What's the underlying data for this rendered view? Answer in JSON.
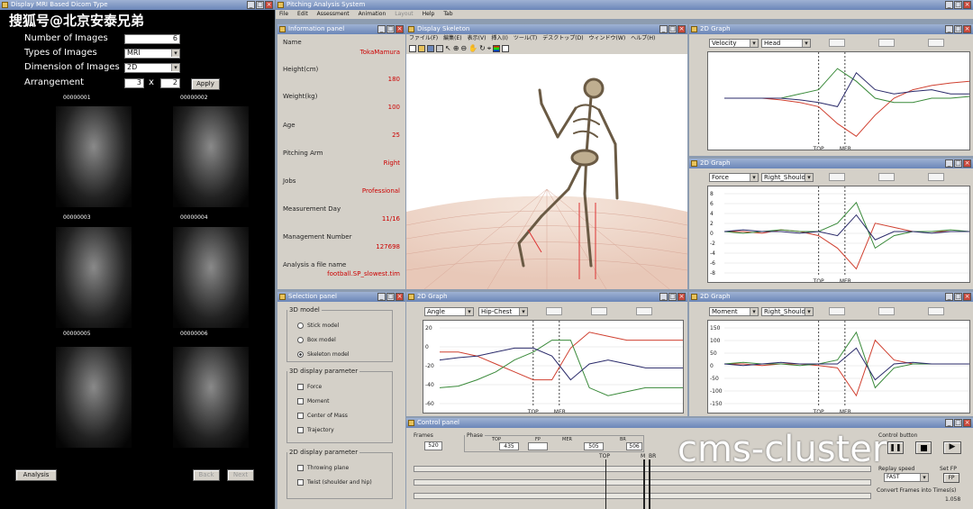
{
  "watermarks": {
    "top_left": "搜狐号@北京安泰兄弟",
    "bottom_right": "cms-cluster"
  },
  "mri_window": {
    "title": "Display MRI Based Dicom Type",
    "number_of_images_label": "Number of Images",
    "number_of_images_value": "6",
    "types_label": "Types of Images",
    "types_value": "MRI",
    "dimension_label": "Dimension of Images",
    "dimension_value": "2D",
    "arrangement_label": "Arrangement",
    "arrangement_rows": "3",
    "arrangement_x": "x",
    "arrangement_cols": "2",
    "apply_label": "Apply",
    "image_ids": [
      "00000001",
      "00000002",
      "00000003",
      "00000004",
      "00000005",
      "00000006"
    ],
    "analysis_label": "Analysis",
    "back_label": "Back",
    "next_label": "Next"
  },
  "main_window": {
    "title": "Pitching Analysis System",
    "menu": [
      "File",
      "Edit",
      "Assessment",
      "Animation",
      "Layout",
      "Help",
      "Tab"
    ]
  },
  "info_panel": {
    "title": "Information panel",
    "fields": [
      {
        "label": "Name",
        "value": "TokaMamura"
      },
      {
        "label": "Height(cm)",
        "value": "180"
      },
      {
        "label": "Weight(kg)",
        "value": "100"
      },
      {
        "label": "Age",
        "value": "25"
      },
      {
        "label": "Pitching Arm",
        "value": "Right"
      },
      {
        "label": "Jobs",
        "value": "Professional"
      },
      {
        "label": "Measurement Day",
        "value": "11/16"
      },
      {
        "label": "Management Number",
        "value": "127698"
      },
      {
        "label": "Analysis a file name",
        "value": "football.SP_slowest.tim"
      }
    ]
  },
  "display_window": {
    "title": "Display Skeleton",
    "menu": [
      "ファイル(F)",
      "編集(E)",
      "表示(V)",
      "挿入(I)",
      "ツール(T)",
      "デスクトップ(D)",
      "ウィンドウ(W)",
      "ヘルプ(H)"
    ]
  },
  "selection_panel": {
    "title": "Selection panel",
    "group_3d_model": "3D model",
    "models": [
      "Stick model",
      "Box model",
      "Skeleton model"
    ],
    "selected_model": "Skeleton model",
    "group_3d_params": "3D display parameter",
    "params_3d": [
      "Force",
      "Moment",
      "Center of Mass",
      "Trajectory"
    ],
    "group_2d_params": "2D display parameter",
    "params_2d": [
      "Throwing plane",
      "Twist (shoulder and hip)"
    ]
  },
  "graphs": [
    {
      "title": "2D Graph",
      "quantity": "Velocity",
      "segment": "Head",
      "yticks": [],
      "markers": [
        "TOP",
        "MER"
      ]
    },
    {
      "title": "2D Graph",
      "quantity": "Force",
      "segment": "Right_Shoulder",
      "yticks": [
        "8",
        "6",
        "4",
        "2",
        "0",
        "-2",
        "-4",
        "-6",
        "-8"
      ],
      "markers": [
        "TOP",
        "MER"
      ]
    },
    {
      "title": "2D Graph",
      "quantity": "Angle",
      "segment": "Hip-Chest",
      "yticks": [
        "20",
        "0",
        "-20",
        "-40",
        "-60"
      ],
      "markers": [
        "TOP",
        "MER"
      ]
    },
    {
      "title": "2D Graph",
      "quantity": "Moment",
      "segment": "Right_Shoulder",
      "yticks": [
        "150",
        "100",
        "50",
        "0",
        "-50",
        "-100",
        "-150"
      ],
      "markers": [
        "TOP",
        "MER"
      ]
    }
  ],
  "control_panel": {
    "title": "Control panel",
    "frames_label": "Frames",
    "frames_value": "520",
    "phase_label": "Phase",
    "phases": [
      {
        "name": "TOP",
        "value": "435"
      },
      {
        "name": "FP",
        "value": ""
      },
      {
        "name": "MER",
        "value": "505"
      },
      {
        "name": "BR",
        "value": "506"
      }
    ],
    "marker_top": "TOP",
    "marker_m": "M",
    "marker_br": "BR",
    "control_button_label": "Control button",
    "replay_speed_label": "Replay speed",
    "replay_speed_value": "FAST",
    "set_fp_label": "Set FP",
    "set_fp_button": "FP",
    "convert_label": "Convert Frames into Times(s)",
    "convert_value": "1.058"
  }
}
